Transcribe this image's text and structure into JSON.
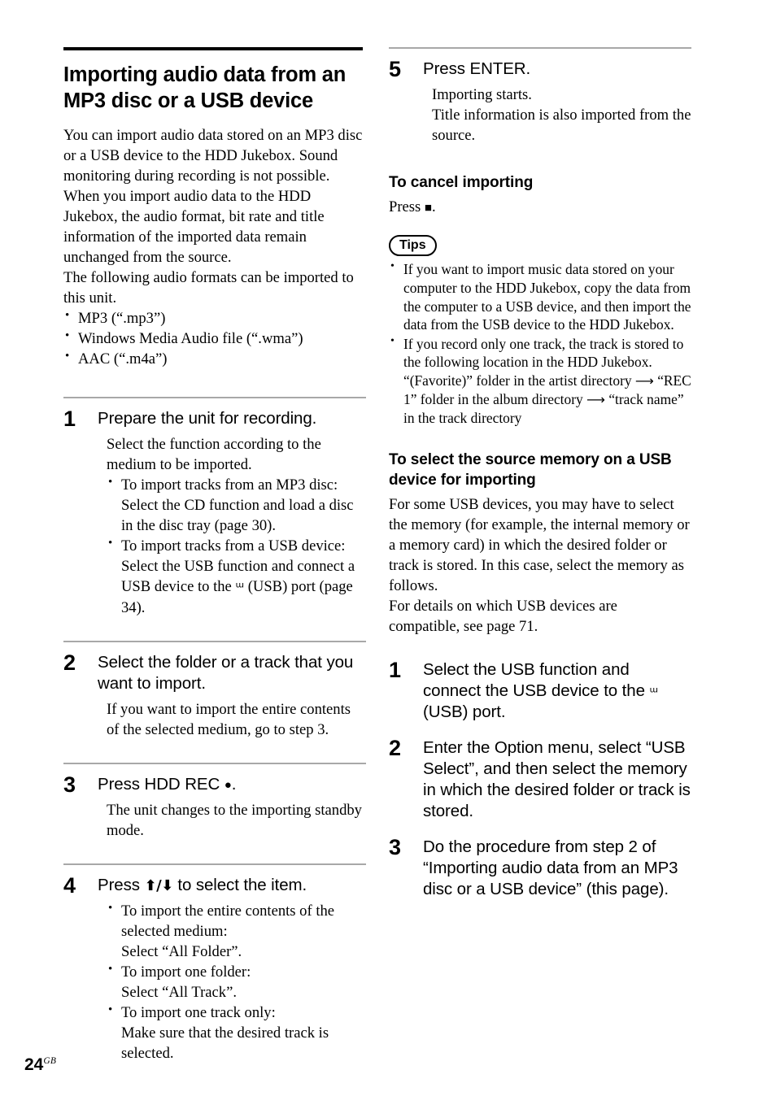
{
  "page": {
    "number": "24",
    "region_suffix": "GB"
  },
  "left_column": {
    "title": "Importing audio data from an MP3 disc or a USB device",
    "intro_paragraphs": [
      "You can import audio data stored on an MP3 disc or a USB device to the HDD Jukebox. Sound monitoring during recording is not possible. When you import audio data to the HDD Jukebox, the audio format, bit rate and title information of the imported data remain unchanged from the source.",
      "The following audio formats can be imported to this unit."
    ],
    "format_list": [
      "MP3 (“.mp3”)",
      "Windows Media Audio file (“.wma”)",
      "AAC (“.m4a”)"
    ],
    "steps": [
      {
        "number": "1",
        "title": "Prepare the unit for recording.",
        "body": "Select the function according to the medium to be imported.",
        "bullets": [
          "To import tracks from an MP3 disc: Select the CD function and load a disc in the disc tray (page 30).",
          "To import tracks from a USB device: Select the USB function and connect a USB device to the ᵚ (USB) port (page 34)."
        ],
        "bullet_1_line1": "To import tracks from an MP3 disc:",
        "bullet_1_line2": "Select the CD function and load a disc in the disc tray (page 30).",
        "bullet_2_line1": "To import tracks from a USB device:",
        "bullet_2_line2_pre": "Select the USB function and connect a USB device to the ",
        "bullet_2_line2_post": " (USB) port (page 34)."
      },
      {
        "number": "2",
        "title": "Select the folder or a track that you want to import.",
        "body": "If you want to import the entire contents of the selected medium, go to step 3."
      },
      {
        "number": "3",
        "title_pre": "Press HDD REC ",
        "title_icon": "record-dot",
        "title_post": ".",
        "body": "The unit changes to the importing standby mode."
      },
      {
        "number": "4",
        "title_pre": "Press ",
        "title_arrows": "⬆/⬇",
        "title_post": " to select the item.",
        "bullets": [
          {
            "line1": "To import the entire contents of the selected medium:",
            "line2": "Select “All Folder”."
          },
          {
            "line1": "To import one folder:",
            "line2": "Select “All Track”."
          },
          {
            "line1": "To import one track only:",
            "line2": "Make sure that the desired track is selected."
          }
        ]
      }
    ]
  },
  "right_column": {
    "step5": {
      "number": "5",
      "title": "Press ENTER.",
      "body_line1": "Importing starts.",
      "body_line2": "Title information is also imported from the source."
    },
    "cancel_section": {
      "heading": "To cancel importing",
      "text_pre": "Press ",
      "icon": "stop-square",
      "text_post": "."
    },
    "tips": {
      "badge_label": "Tips",
      "items": [
        "If you want to import music data stored on your computer to the HDD Jukebox, copy the data from the computer to a USB device, and then import the data from the USB device to the HDD Jukebox.",
        "If you record only one track, the track is stored to the following location in the HDD Jukebox."
      ],
      "path_line_1_pre": "“(Favorite)” folder in the artist directory ",
      "path_arrow": "⟶",
      "path_line_1_post": " “REC 1” folder in the album directory ",
      "path_line_2_post": " “track name” in the track directory"
    },
    "source_memory_section": {
      "heading": "To select the source memory on a USB device for importing",
      "paragraph_1": "For some USB devices, you may have to select the memory (for example, the internal memory or a memory card) in which the desired folder or track is stored. In this case, select the memory as follows.",
      "paragraph_2": "For details on which USB devices are compatible, see page 71.",
      "steps": [
        {
          "number": "1",
          "title_pre": "Select the USB function and connect the USB device to the ",
          "title_post": " (USB) port."
        },
        {
          "number": "2",
          "title": "Enter the Option menu, select “USB Select”, and then select the memory in which the desired folder or track is stored."
        },
        {
          "number": "3",
          "title": "Do the procedure from step 2 of “Importing audio data from an MP3 disc or a USB device” (this page)."
        }
      ]
    }
  },
  "icons": {
    "usb_trident": "ᵚ",
    "record_dot": "●",
    "stop_square": "■",
    "arrow_up": "⬆",
    "arrow_down": "⬇",
    "arrow_right_long": "⟶"
  }
}
